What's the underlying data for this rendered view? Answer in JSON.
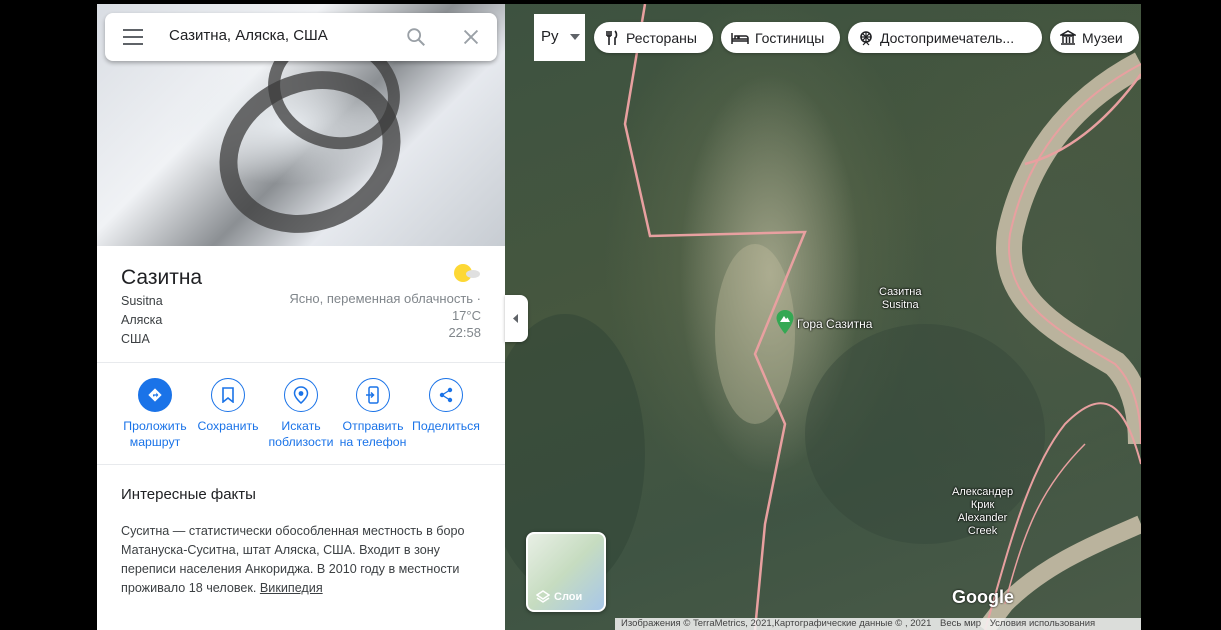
{
  "search": {
    "query": "Сазитна, Аляска, США"
  },
  "place": {
    "title": "Сазитна",
    "lines": [
      "Susitna",
      "Аляска",
      "США"
    ],
    "weather_condition": "Ясно, переменная облачность ·",
    "temperature": "17°C",
    "time": "22:58"
  },
  "actions": [
    {
      "label1": "Проложить",
      "label2": "маршрут",
      "icon": "directions-icon"
    },
    {
      "label1": "Сохранить",
      "label2": "",
      "icon": "bookmark-icon"
    },
    {
      "label1": "Искать",
      "label2": "поблизости",
      "icon": "nearby-icon"
    },
    {
      "label1": "Отправить",
      "label2": "на телефон",
      "icon": "send-to-phone-icon"
    },
    {
      "label1": "Поделиться",
      "label2": "",
      "icon": "share-icon"
    }
  ],
  "facts": {
    "title": "Интересные факты",
    "text": "Суситна — статистически обособленная местность в боро Матануска-Суситна, штат Аляска, США. Входит в зону переписи населения Анкориджа. В 2010 году в местности проживало 18 человек.",
    "link": "Википедия"
  },
  "map": {
    "language": "Ру",
    "chips": [
      "Рестораны",
      "Гостиницы",
      "Достопримечатель...",
      "Музеи"
    ],
    "layers_label": "Слои",
    "labels": {
      "susitna_ru": "Сазитна",
      "susitna_en": "Susitna",
      "poi": "Гора Сазитна",
      "alex_ru1": "Александер",
      "alex_ru2": "Крик",
      "alex_en1": "Alexander",
      "alex_en2": "Creek"
    },
    "logo": "Google",
    "footer": {
      "attribution": "Изображения © TerraMetrics, 2021,Картографические данные © , 2021",
      "scope": "Весь мир",
      "terms": "Условия использования"
    },
    "colors": {
      "boundary": "#e8a0a0",
      "river": "#d9c9b0",
      "accent": "#1a73e8"
    }
  }
}
